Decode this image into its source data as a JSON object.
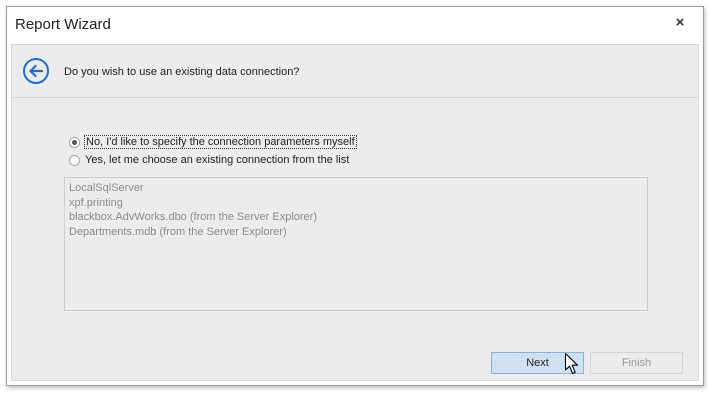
{
  "window": {
    "title": "Report Wizard",
    "close_label": "×"
  },
  "header": {
    "back_icon": "back-arrow-icon",
    "question": "Do you wish to use an existing data connection?"
  },
  "options": {
    "specify_label": "No, I'd like to specify the connection parameters myself",
    "specify_selected": true,
    "existing_label": "Yes, let me choose an existing connection from the list",
    "existing_selected": false
  },
  "connections": [
    "LocalSqlServer",
    "xpf.printing",
    "blackbox.AdvWorks.dbo (from the Server Explorer)",
    "Departments.mdb (from the Server Explorer)"
  ],
  "buttons": {
    "next_label": "Next",
    "finish_label": "Finish",
    "finish_enabled": false
  },
  "colors": {
    "accent": "#1e6fd0",
    "panel": "#ececec",
    "next_fill": "#cfe0f2"
  }
}
